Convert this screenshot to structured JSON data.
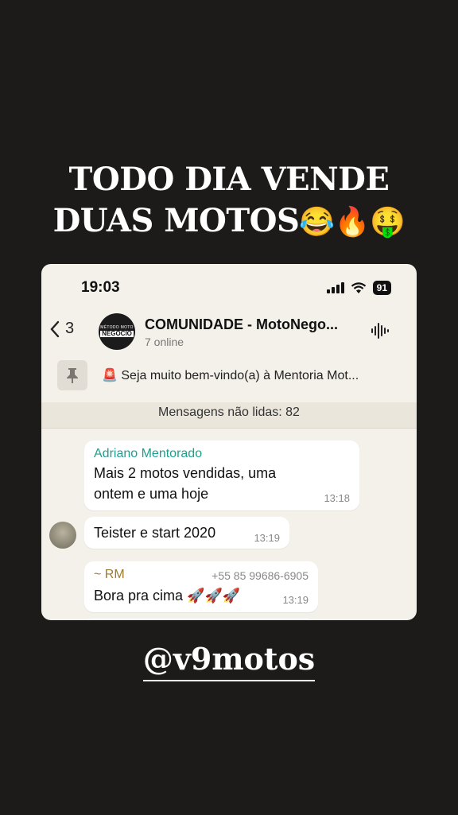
{
  "story": {
    "title_line1": "TODO DIA VENDE",
    "title_line2": "DUAS MOTOS",
    "title_emojis": "😂🔥🤑",
    "handle": "@v9motos"
  },
  "status_bar": {
    "time": "19:03",
    "battery": "91"
  },
  "chat_header": {
    "back_count": "3",
    "group_avatar_small": "MÉTODO MOTO",
    "group_avatar_big": "NEGÓCIO",
    "group_name": "COMUNIDADE - MotoNego...",
    "online": "7 online"
  },
  "pinned": {
    "text": "🚨 Seja muito bem-vindo(a) à Mentoria Mot..."
  },
  "unread": {
    "text": "Mensagens não lidas: 82"
  },
  "messages": [
    {
      "sender": "Adriano Mentorado",
      "text": "Mais 2 motos vendidas, uma ontem e uma hoje",
      "time": "13:18"
    },
    {
      "sender": "",
      "text": "Teister e start 2020",
      "time": "13:19"
    },
    {
      "sender": "~ RM",
      "phone": "+55 85 99686-6905",
      "text": "Bora pra cima 🚀🚀🚀",
      "time": "13:19"
    }
  ],
  "icons": {
    "back": "chevron-left-icon",
    "signal": "signal-icon",
    "wifi": "wifi-icon",
    "audio": "audio-wave-icon",
    "pin": "pin-icon"
  },
  "colors": {
    "background": "#1c1b1a",
    "card": "#f4f1ea",
    "sender_green": "#1f9e8e",
    "sender_gold": "#a07a2c"
  }
}
